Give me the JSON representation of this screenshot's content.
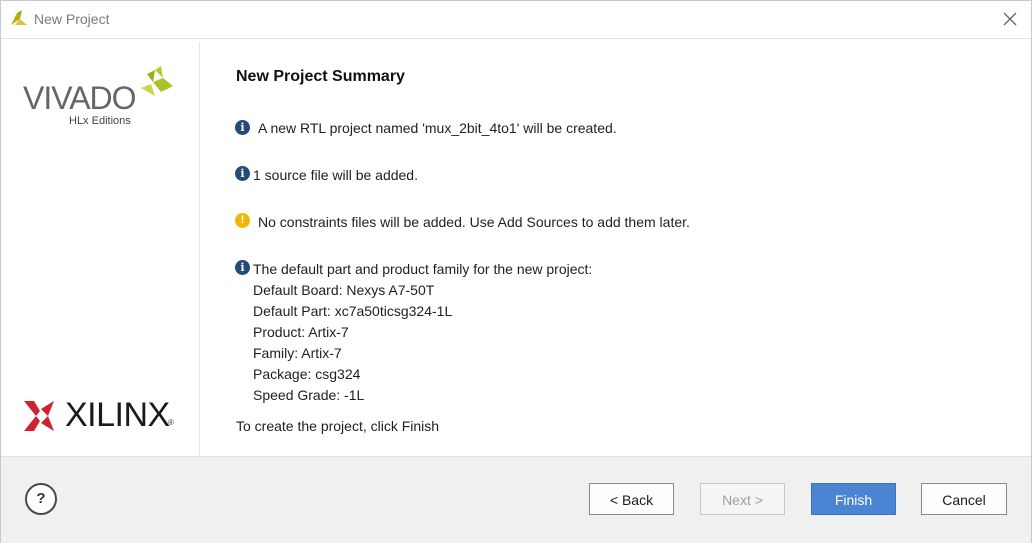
{
  "window": {
    "title": "New Project"
  },
  "branding": {
    "product": "VIVADO",
    "edition": "HLx Editions",
    "company": "XILINX",
    "registered": "®"
  },
  "summary": {
    "heading": "New Project Summary",
    "messages": [
      {
        "type": "info",
        "text": "A new RTL project named 'mux_2bit_4to1' will be created."
      },
      {
        "type": "info",
        "text": "1 source file will be added."
      },
      {
        "type": "warning",
        "text": "No constraints files will be added. Use Add Sources to add them later."
      },
      {
        "type": "info",
        "text": "The default part and product family for the new project:"
      }
    ],
    "details": [
      "Default Board: Nexys A7-50T",
      "Default Part: xc7a50ticsg324-1L",
      "Product: Artix-7",
      "Family: Artix-7",
      "Package: csg324",
      "Speed Grade: -1L"
    ],
    "footer_note": "To create the project, click Finish"
  },
  "buttons": {
    "help": "?",
    "back": "< Back",
    "next": "Next >",
    "finish": "Finish",
    "cancel": "Cancel"
  },
  "colors": {
    "info": "#244a7a",
    "warning": "#f2b705",
    "primary_button": "#4a85d3"
  }
}
